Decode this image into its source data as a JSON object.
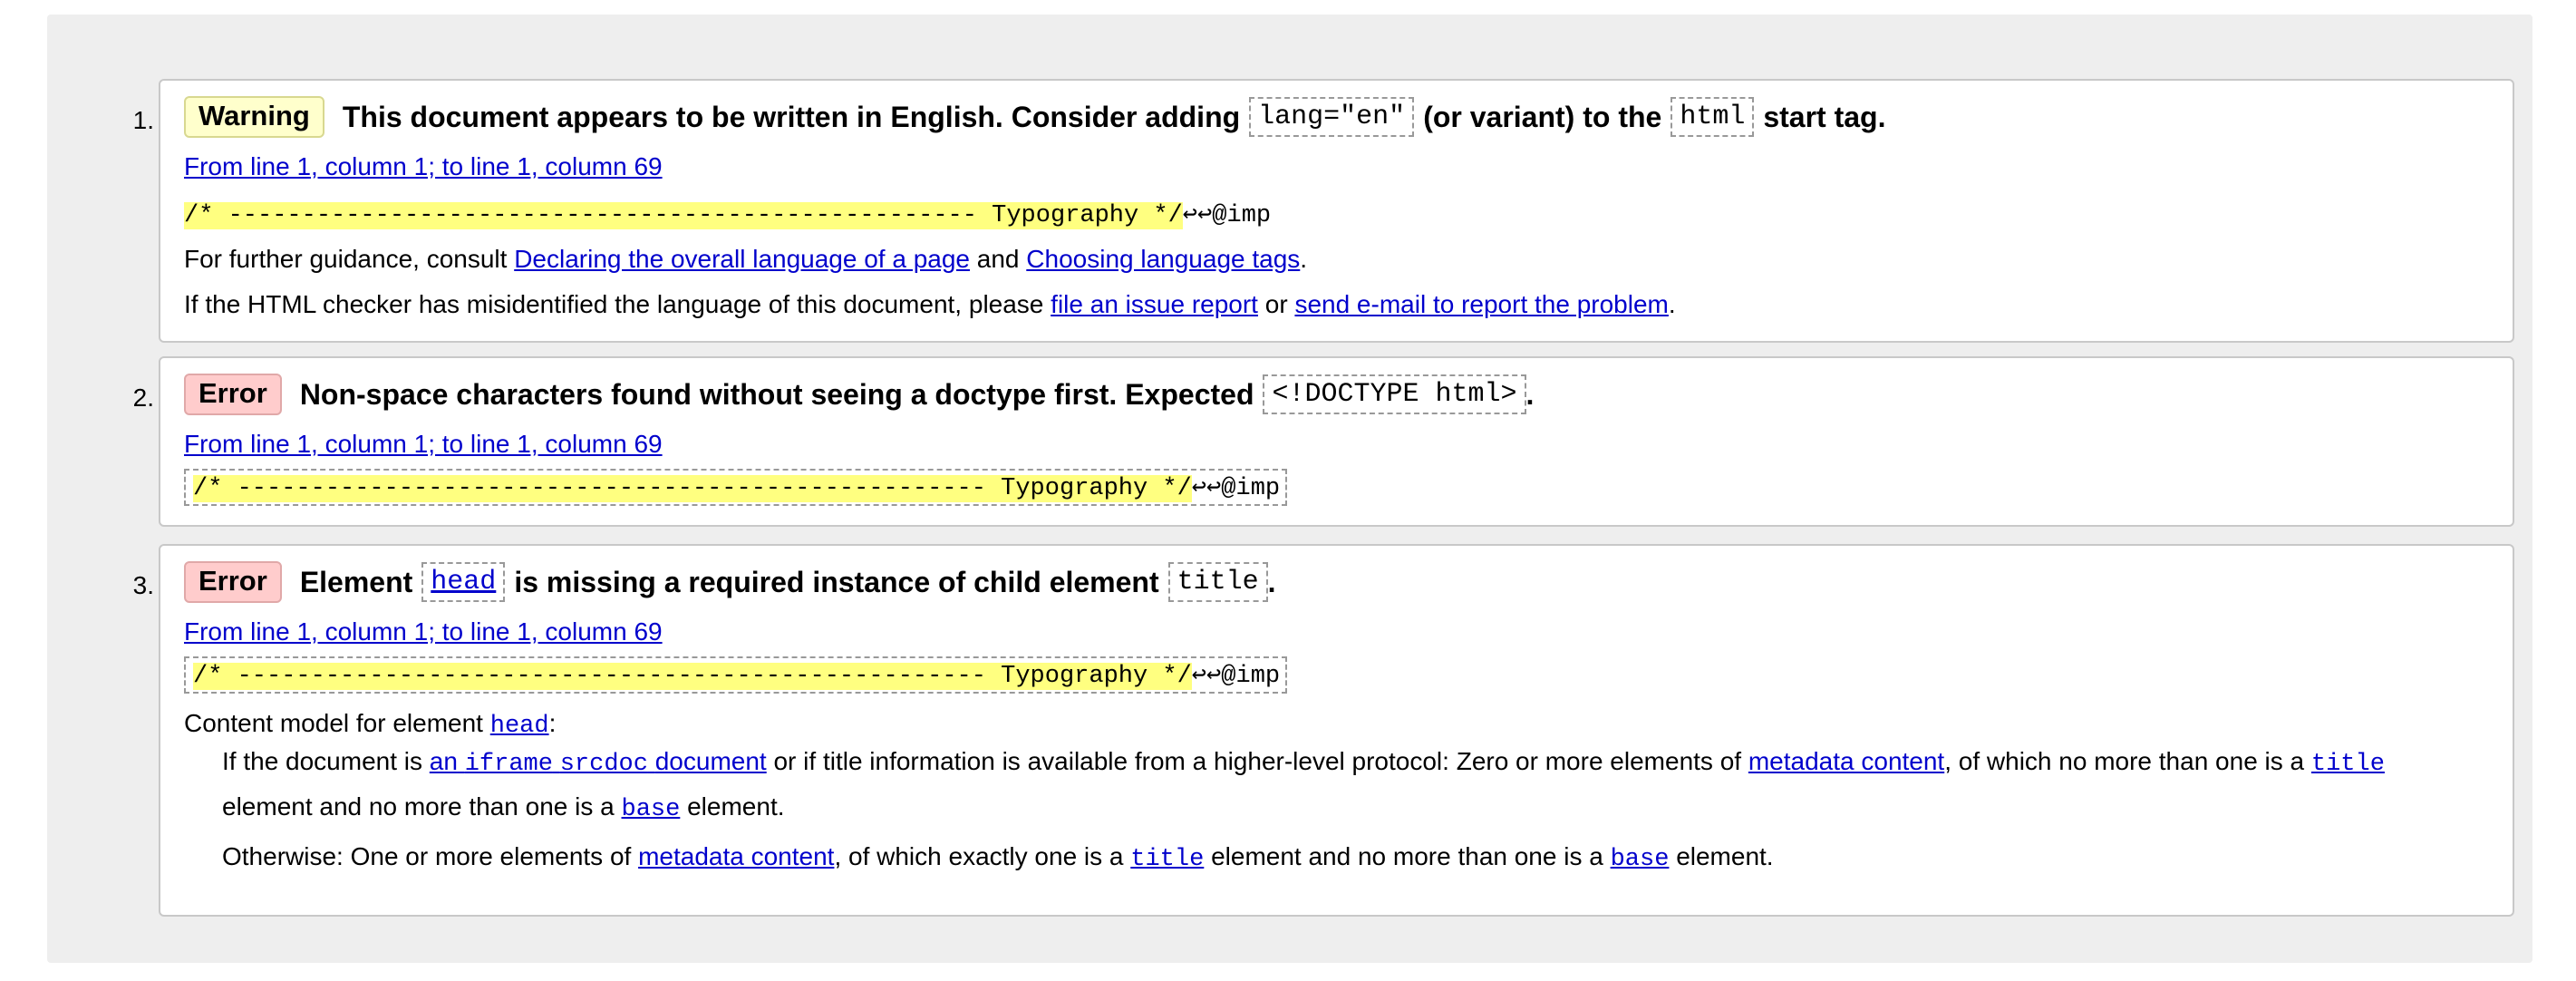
{
  "messages": [
    {
      "number": "1.",
      "badge": "Warning",
      "head_a": "This document appears to be written in English. Consider adding",
      "code_a": "lang=\"en\"",
      "head_b": "(or variant) to the",
      "code_b": "html",
      "head_c": "start tag.",
      "location": "From line 1, column 1; to line 1, column 69",
      "extract_hl": "/* --------------------------------------------------- Typography */",
      "extract_rest": "↩↩@imp",
      "guidance_a": "For further guidance, consult",
      "guidance_link1": "Declaring the overall language of a page",
      "guidance_and": "and",
      "guidance_link2": "Choosing language tags",
      "guidance_end": ".",
      "misid_a": "If the HTML checker has misidentified the language of this document, please",
      "misid_link1": "file an issue report",
      "misid_or": "or",
      "misid_link2": "send e-mail to report the problem",
      "misid_end": "."
    },
    {
      "number": "2.",
      "badge": "Error",
      "head_a": "Non-space characters found without seeing a doctype first. Expected",
      "code_a": "<!DOCTYPE html>",
      "head_b": ".",
      "location": "From line 1, column 1; to line 1, column 69",
      "extract_hl": "/* --------------------------------------------------- Typography */",
      "extract_rest": "↩↩@imp"
    },
    {
      "number": "3.",
      "badge": "Error",
      "head_a": "Element",
      "code_a": "head",
      "head_b": "is missing a required instance of child element",
      "code_b": "title",
      "head_c": ".",
      "location": "From line 1, column 1; to line 1, column 69",
      "extract_hl": "/* --------------------------------------------------- Typography */",
      "extract_rest": "↩↩@imp",
      "model_a": "Content model for element",
      "model_link": "head",
      "model_end": ":",
      "dd1_a": "If the document is",
      "dd1_link1a": "an",
      "dd1_link1b": "iframe",
      "dd1_link1c": "srcdoc",
      "dd1_link1d": "document",
      "dd1_b": "or if title information is available from a higher-level protocol: Zero or more elements of",
      "dd1_link2": "metadata content",
      "dd1_c": ", of which no more than one is a",
      "dd1_link3": "title",
      "dd1_d": "element and no more than one is a",
      "dd1_link4": "base",
      "dd1_e": "element.",
      "dd2_a": "Otherwise: One or more elements of",
      "dd2_link1": "metadata content",
      "dd2_b": ", of which exactly one is a",
      "dd2_link2": "title",
      "dd2_c": "element and no more than one is a",
      "dd2_link3": "base",
      "dd2_d": "element."
    }
  ]
}
